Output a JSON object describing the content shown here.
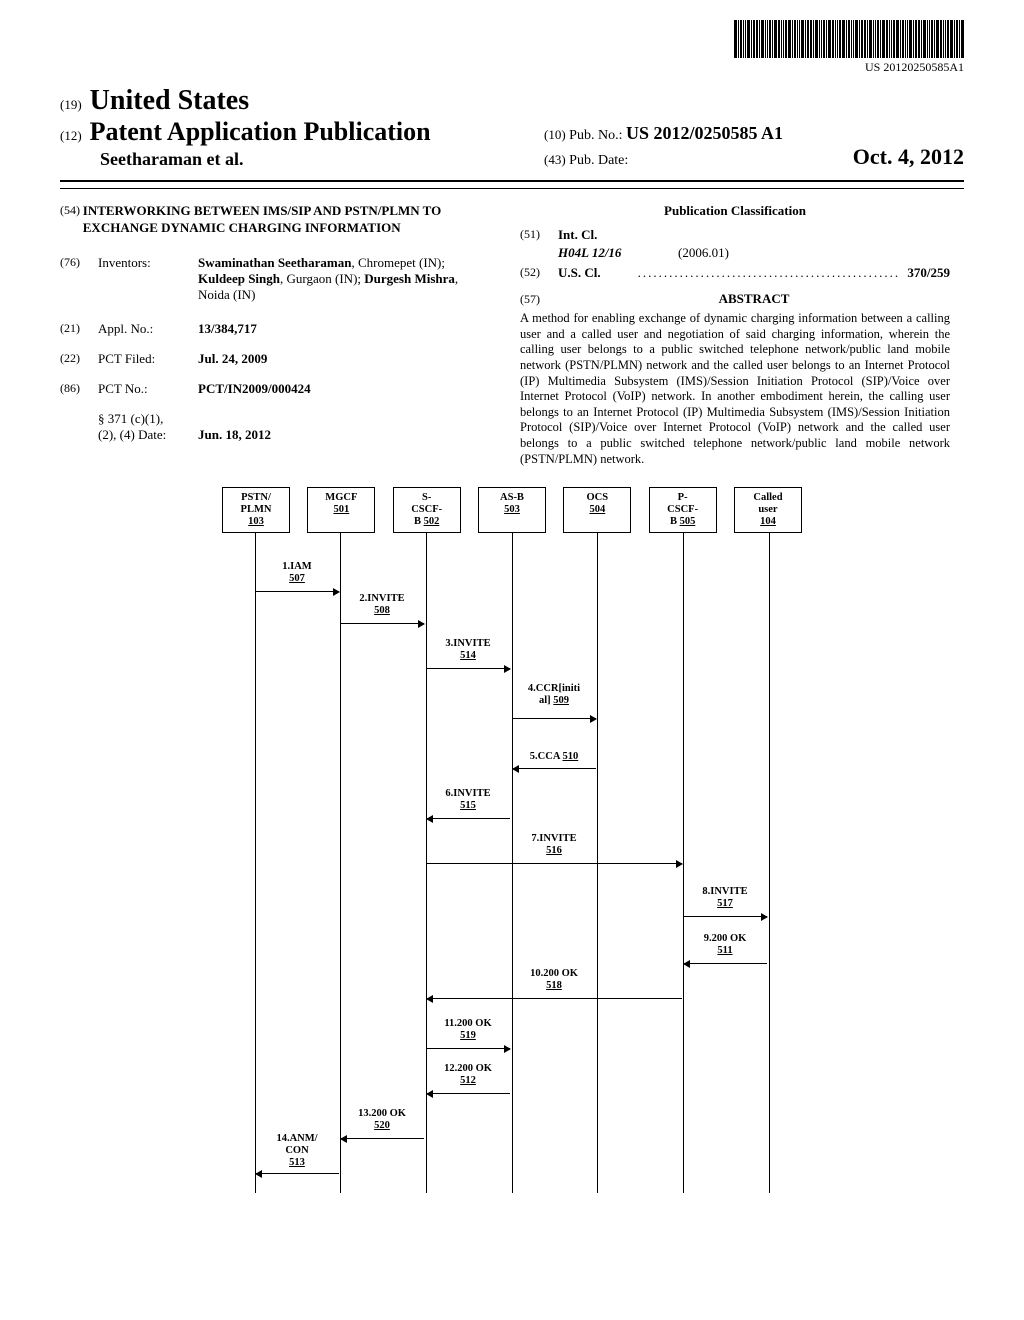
{
  "barcode_text": "US 20120250585A1",
  "header": {
    "num19": "(19)",
    "country": "United States",
    "num12": "(12)",
    "doc_type": "Patent Application Publication",
    "authors": "Seetharaman et al.",
    "num10": "(10)",
    "pub_no_label": "Pub. No.:",
    "pub_no": "US 2012/0250585 A1",
    "num43": "(43)",
    "pub_date_label": "Pub. Date:",
    "pub_date": "Oct. 4, 2012"
  },
  "left": {
    "num54": "(54)",
    "title": "INTERWORKING BETWEEN IMS/SIP AND PSTN/PLMN TO EXCHANGE DYNAMIC CHARGING INFORMATION",
    "num76": "(76)",
    "inventors_label": "Inventors:",
    "inventors_val_1": "Swaminathan Seetharaman",
    "inventors_val_2": ", Chromepet (IN); ",
    "inventors_val_3": "Kuldeep Singh",
    "inventors_val_4": ", Gurgaon (IN); ",
    "inventors_val_5": "Durgesh Mishra",
    "inventors_val_6": ", Noida (IN)",
    "num21": "(21)",
    "applno_label": "Appl. No.:",
    "applno": "13/384,717",
    "num22": "(22)",
    "pctfiled_label": "PCT Filed:",
    "pctfiled": "Jul. 24, 2009",
    "num86": "(86)",
    "pctno_label": "PCT No.:",
    "pctno": "PCT/IN2009/000424",
    "s371_label": "§ 371 (c)(1),",
    "s371_label2": "(2), (4) Date:",
    "s371_date": "Jun. 18, 2012"
  },
  "right": {
    "classif_title": "Publication Classification",
    "num51": "(51)",
    "intcl_label": "Int. Cl.",
    "intcl_code": "H04L 12/16",
    "intcl_year": "(2006.01)",
    "num52": "(52)",
    "uscl_label": "U.S. Cl.",
    "uscl_val": "370/259",
    "num57": "(57)",
    "abstract_label": "ABSTRACT",
    "abstract_body": "A method for enabling exchange of dynamic charging information between a calling user and a called user and negotiation of said charging information, wherein the calling user belongs to a public switched telephone network/public land mobile network (PSTN/PLMN) network and the called user belongs to an Internet Protocol (IP) Multimedia Subsystem (IMS)/Session Initiation Protocol (SIP)/Voice over Internet Protocol (VoIP) network. In another embodiment herein, the calling user belongs to an Internet Protocol (IP) Multimedia Subsystem (IMS)/Session Initiation Protocol (SIP)/Voice over Internet Protocol (VoIP) network and the called user belongs to a public switched telephone network/public land mobile network (PSTN/PLMN) network."
  },
  "diagram": {
    "actors": [
      {
        "label": "PSTN/\nPLMN",
        "ref": "103"
      },
      {
        "label": "MGCF",
        "ref": "501"
      },
      {
        "label": "S-\nCSCF-\nB",
        "ref": "502"
      },
      {
        "label": "AS-B",
        "ref": "503"
      },
      {
        "label": "OCS",
        "ref": "504"
      },
      {
        "label": "P-\nCSCF-\nB",
        "ref": "505"
      },
      {
        "label": "Called\nuser",
        "ref": "104"
      }
    ],
    "messages": [
      {
        "text": "1.IAM",
        "ref": "507"
      },
      {
        "text": "2.INVITE",
        "ref": "508"
      },
      {
        "text": "3.INVITE",
        "ref": "514"
      },
      {
        "text": "4.CCR[initi\nal]",
        "ref": "509"
      },
      {
        "text": "5.CCA",
        "ref": "510"
      },
      {
        "text": "6.INVITE",
        "ref": "515"
      },
      {
        "text": "7.INVITE",
        "ref": "516"
      },
      {
        "text": "8.INVITE",
        "ref": "517"
      },
      {
        "text": "9.200 OK",
        "ref": "511"
      },
      {
        "text": "10.200 OK",
        "ref": "518"
      },
      {
        "text": "11.200 OK",
        "ref": "519"
      },
      {
        "text": "12.200 OK",
        "ref": "512"
      },
      {
        "text": "13.200 OK",
        "ref": "520"
      },
      {
        "text": "14.ANM/\nCON",
        "ref": "513"
      }
    ]
  }
}
